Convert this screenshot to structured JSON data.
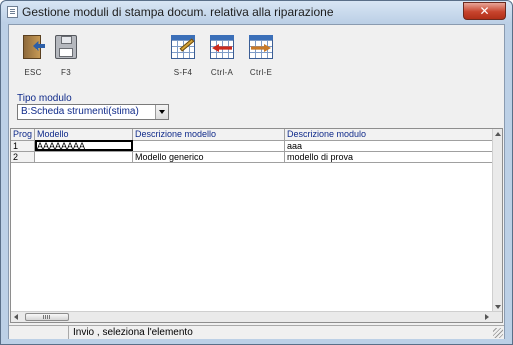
{
  "window": {
    "title": "Gestione moduli di stampa docum. relativa alla riparazione",
    "close_symbol": "✕"
  },
  "toolbar": {
    "buttons": [
      {
        "label": "ESC",
        "icon": "exit-door-icon"
      },
      {
        "label": "F3",
        "icon": "floppy-save-icon"
      },
      {
        "label": "S-F4",
        "icon": "grid-edit-icon"
      },
      {
        "label": "Ctrl-A",
        "icon": "grid-arrow-left-icon"
      },
      {
        "label": "Ctrl-E",
        "icon": "grid-arrow-right-icon"
      }
    ]
  },
  "tipo_modulo": {
    "label": "Tipo modulo",
    "value": "B:Scheda strumenti(stima)"
  },
  "grid": {
    "columns": [
      "Prog",
      "Modello",
      "Descrizione modello",
      "Descrizione modulo"
    ],
    "rows": [
      {
        "prog": "1",
        "modello": "AAAAAAAA",
        "descrizione_modello": "",
        "descrizione_modulo": "aaa"
      },
      {
        "prog": "2",
        "modello": "",
        "descrizione_modello": "Modello generico",
        "descrizione_modulo": "modello di prova"
      }
    ]
  },
  "statusbar": {
    "text": "Invio , seleziona l'elemento"
  },
  "colors": {
    "window_frame": "#bcd0e6",
    "label_blue": "#0f2a8a",
    "close_red": "#c7442d"
  }
}
